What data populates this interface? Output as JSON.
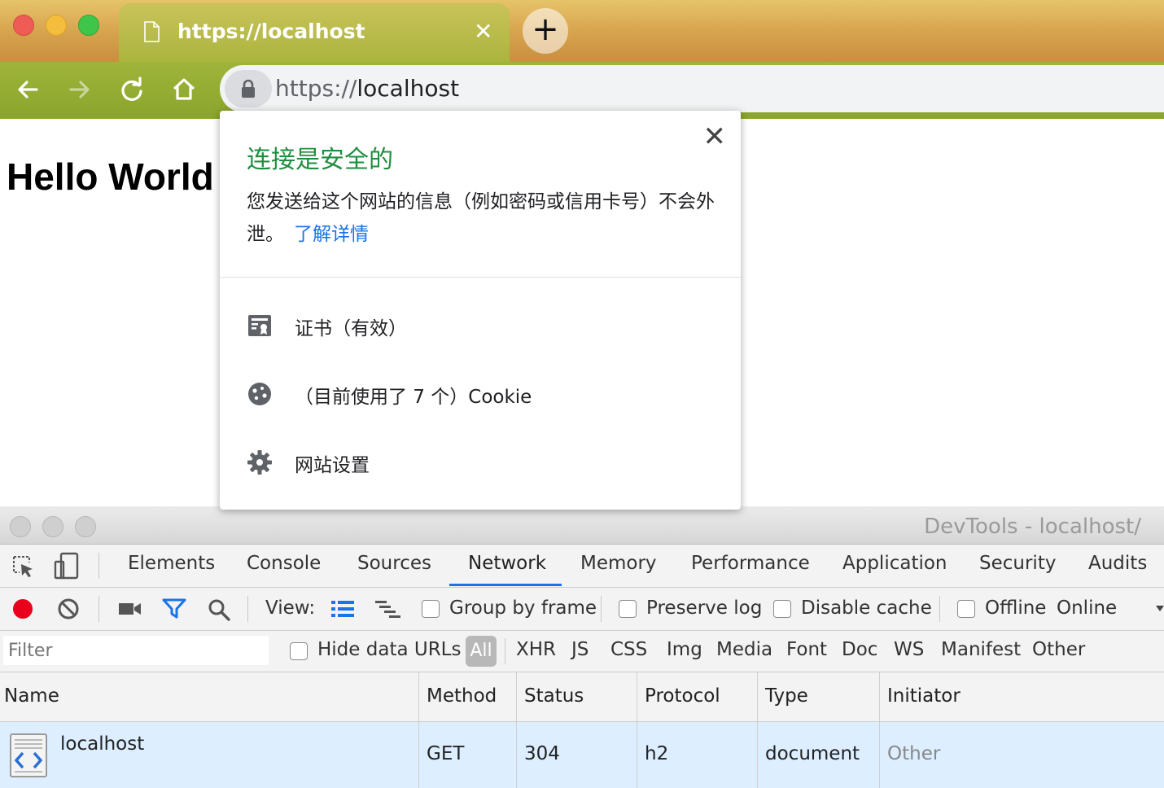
{
  "tab": {
    "title": "https://localhost",
    "close_glyph": "✕",
    "new_tab_glyph": "+"
  },
  "omnibox": {
    "scheme": "https://",
    "host": "localhost"
  },
  "page": {
    "heading": "Hello World"
  },
  "popup": {
    "title": "连接是安全的",
    "description": "您发送给这个网站的信息（例如密码或信用卡号）不会外泄。",
    "learn_more": "了解详情",
    "close_glyph": "✕",
    "items": [
      {
        "icon": "certificate-icon",
        "label": "证书（有效）"
      },
      {
        "icon": "cookie-icon",
        "label": "（目前使用了 7 个）Cookie"
      },
      {
        "icon": "gear-icon",
        "label": "网站设置"
      }
    ],
    "accent": "#1e8e3e",
    "link_color": "#1a73e8"
  },
  "devtools": {
    "title": "DevTools - localhost/",
    "tabs": [
      "Elements",
      "Console",
      "Sources",
      "Network",
      "Memory",
      "Performance",
      "Application",
      "Security",
      "Audits"
    ],
    "active_tab": "Network",
    "netbar": {
      "view_label": "View:",
      "group_by_frame": "Group by frame",
      "preserve_log": "Preserve log",
      "disable_cache": "Disable cache",
      "offline": "Offline",
      "throttling": "Online"
    },
    "filter": {
      "placeholder": "Filter",
      "hide_data_urls": "Hide data URLs",
      "types": [
        "All",
        "XHR",
        "JS",
        "CSS",
        "Img",
        "Media",
        "Font",
        "Doc",
        "WS",
        "Manifest",
        "Other"
      ]
    },
    "table": {
      "columns": [
        "Name",
        "Method",
        "Status",
        "Protocol",
        "Type",
        "Initiator"
      ],
      "rows": [
        {
          "name": "localhost",
          "method": "GET",
          "status": "304",
          "protocol": "h2",
          "type": "document",
          "initiator": "Other"
        }
      ]
    },
    "record_color": "#e8001c",
    "accent": "#1a73e8"
  }
}
